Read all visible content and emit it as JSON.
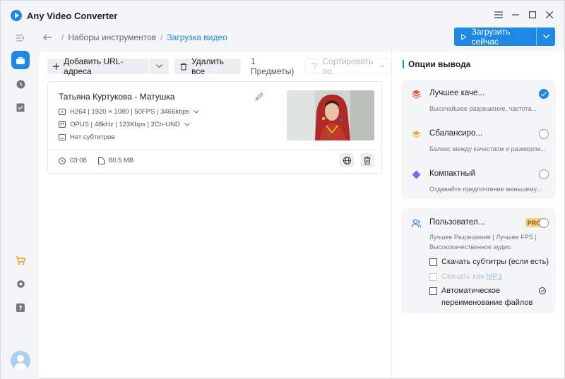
{
  "app": {
    "title": "Any Video Converter"
  },
  "breadcrumb": {
    "root": "Наборы инструментов",
    "current": "Загрузка видео"
  },
  "actions": {
    "download_now": "Загрузить сейчас"
  },
  "toolbar": {
    "add_url": "Добавить URL-адреса",
    "delete_all": "Удалить все",
    "items_count": "1 Предметы)",
    "sort_by": "Сортировать по"
  },
  "video": {
    "title": "Татьяна Куртукова - Матушка",
    "video_stream": "H264 | 1920 × 1080 | 50FPS | 3466kbps",
    "audio_stream": "OPUS | 48kHz | 123Kbps | 2Ch-UND",
    "subtitles": "Нет субтитров",
    "duration": "03:08",
    "size": "80.5 MB"
  },
  "output": {
    "title": "Опции вывода",
    "options": [
      {
        "name": "Лучшее каче...",
        "desc": "Высочайшее разрешение, частота...",
        "selected": true,
        "color": "#e8503a"
      },
      {
        "name": "Сбалансиро...",
        "desc": "Баланс между качеством и размером...",
        "selected": false,
        "color": "#f5a623"
      },
      {
        "name": "Компактный",
        "desc": "Отдавайте предпочтение меньшему...",
        "selected": false,
        "color": "#6c6ff0"
      }
    ],
    "custom": {
      "name": "Пользовател...",
      "badge": "PRO",
      "desc_line1": "Лучшее Разрешение | Лучшее FPS |",
      "desc_line2": "Высококачественное аудио.",
      "chk_subtitles": "Скачать субтитры (если есть)",
      "chk_mp3_prefix": "Скачать как ",
      "chk_mp3_link": "MP3",
      "chk_rename_line1": "Автоматическое",
      "chk_rename_line2": "переименование файлов"
    }
  },
  "colors": {
    "accent": "#1e88e5"
  }
}
